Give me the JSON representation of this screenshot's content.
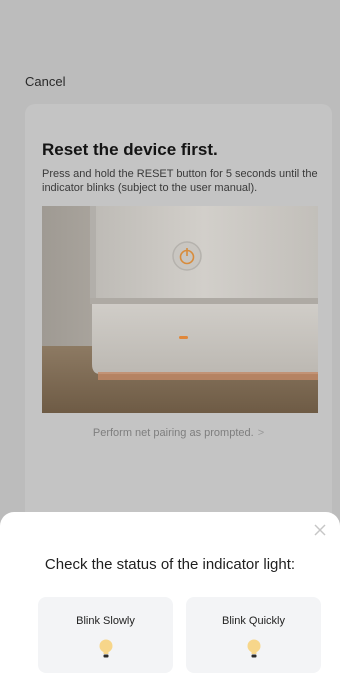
{
  "nav": {
    "cancel_label": "Cancel"
  },
  "card": {
    "title": "Reset the device first.",
    "description": "Press and hold the RESET button for 5 seconds until the indicator blinks (subject to the user manual).",
    "pairing_link": "Perform net pairing as prompted.",
    "pairing_chevron": ">"
  },
  "sheet": {
    "title": "Check the status of the indicator light:",
    "close_icon": "close-icon",
    "options": [
      {
        "label": "Blink Slowly",
        "icon": "lightbulb-icon"
      },
      {
        "label": "Blink Quickly",
        "icon": "lightbulb-icon"
      }
    ]
  },
  "colors": {
    "overlay": "#bcbcbc",
    "sheet_bg": "#ffffff",
    "option_bg": "#f3f4f6",
    "bulb": "#f7d68a",
    "indicator": "#e0873a"
  }
}
